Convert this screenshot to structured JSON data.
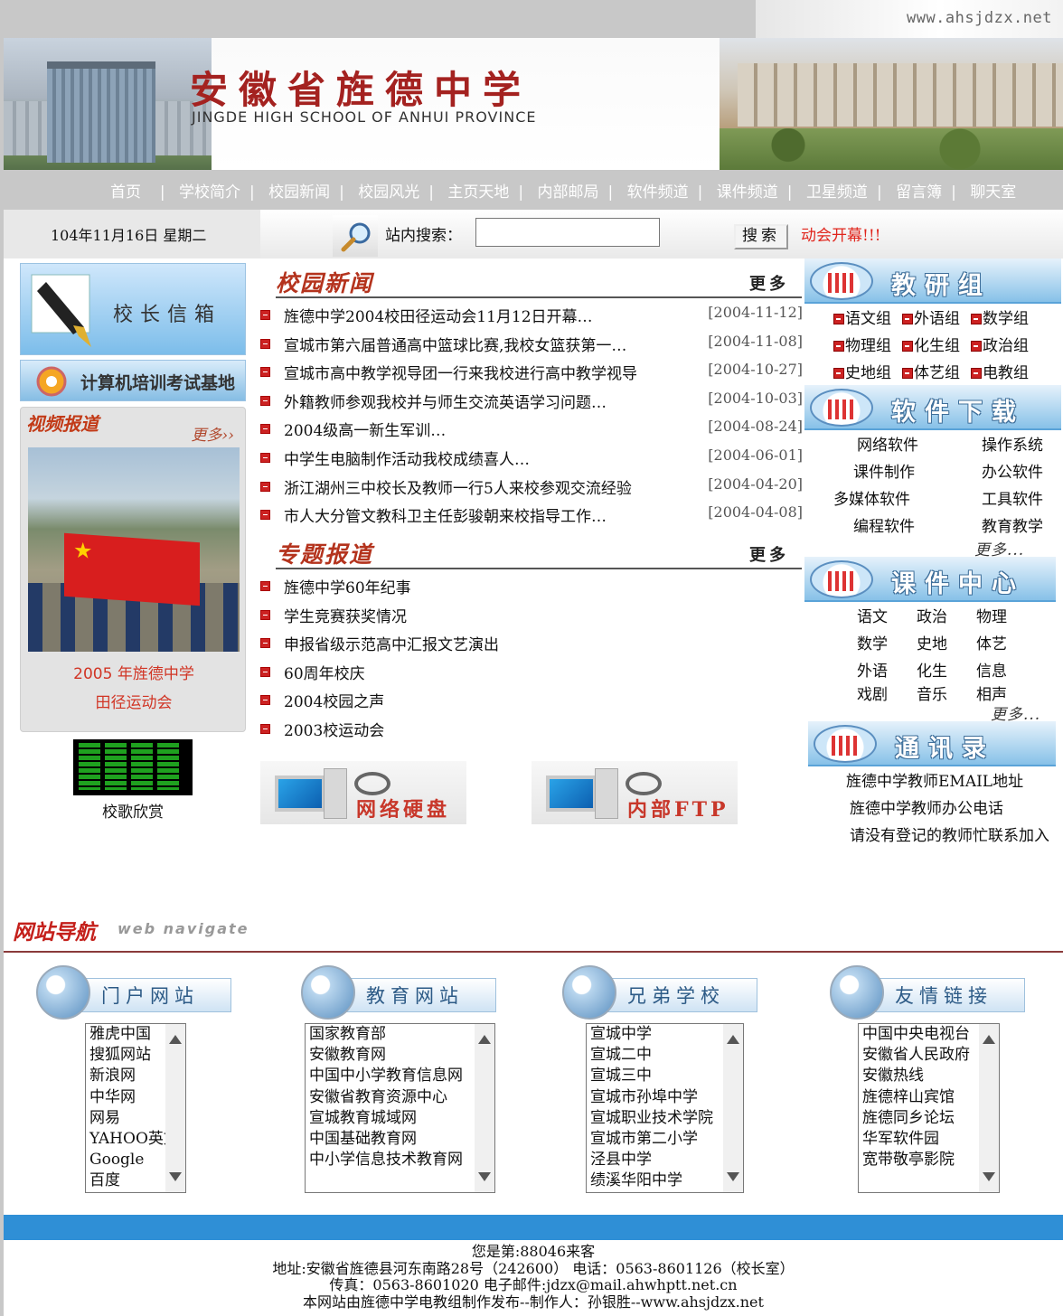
{
  "top": {
    "url": "www.ahsjdzx.net"
  },
  "banner": {
    "title": "安徽省旌德中学",
    "subtitle": "JINGDE HIGH SCHOOL OF ANHUI PROVINCE"
  },
  "nav": {
    "items": [
      "首页",
      "学校简介",
      "校园新闻",
      "校园风光",
      "主页天地",
      "内部邮局",
      "软件频道",
      "课件频道",
      "卫星频道",
      "留言簿",
      "聊天室"
    ]
  },
  "date_text": "104年11月16日  星期二",
  "search": {
    "label": "站内搜索：",
    "value": "",
    "button": "搜索",
    "marquee": "动会开幕!!!"
  },
  "left": {
    "mailbox_label": "校长信箱",
    "training_label": "计算机培训考试基地",
    "video_title": "视频报道",
    "video_more": "更多››",
    "video_caption_1": "2005 年旌德中学",
    "video_caption_2": "田径运动会",
    "song_label": "校歌欣赏"
  },
  "news": {
    "title": "校园新闻",
    "more": "更多",
    "items": [
      {
        "text": "旌德中学2004校田径运动会11月12日开幕…",
        "date": "[2004-11-12]"
      },
      {
        "text": "宣城市第六届普通高中篮球比赛,我校女篮获第一…",
        "date": "[2004-11-08]"
      },
      {
        "text": "宣城市高中教学视导团一行来我校进行高中教学视导",
        "date": "[2004-10-27]"
      },
      {
        "text": "外籍教师参观我校并与师生交流英语学习问题…",
        "date": "[2004-10-03]"
      },
      {
        "text": "2004级高一新生军训…",
        "date": "[2004-08-24]"
      },
      {
        "text": "中学生电脑制作活动我校成绩喜人…",
        "date": "[2004-06-01]"
      },
      {
        "text": "浙江湖州三中校长及教师一行5人来校参观交流经验",
        "date": "[2004-04-20]"
      },
      {
        "text": "市人大分管文教科卫主任彭骏朝来校指导工作…",
        "date": "[2004-04-08]"
      }
    ]
  },
  "topics": {
    "title": "专题报道",
    "more": "更多",
    "items": [
      "旌德中学60年纪事",
      "学生竞赛获奖情况",
      "申报省级示范高中汇报文艺演出",
      "60周年校庆",
      "2004校园之声",
      "2003校运动会"
    ]
  },
  "banners": {
    "disk": "网络硬盘",
    "ftp": "内部FTP"
  },
  "right": {
    "research": {
      "title": "教研组",
      "groups": [
        "语文组",
        "外语组",
        "数学组",
        "物理组",
        "化生组",
        "政治组",
        "史地组",
        "体艺组",
        "电教组"
      ]
    },
    "software": {
      "title": "软件下载",
      "items": [
        "网络软件",
        "操作系统",
        "课件制作",
        "办公软件",
        "多媒体软件",
        "工具软件",
        "编程软件",
        "教育教学"
      ],
      "more": "更多..."
    },
    "courseware": {
      "title": "课件中心",
      "items": [
        "语文",
        "政治",
        "物理",
        "数学",
        "史地",
        "体艺",
        "外语",
        "化生",
        "信息",
        "戏剧",
        "音乐",
        "相声"
      ],
      "more": "更多..."
    },
    "contacts": {
      "title": "通讯录",
      "items": [
        "旌德中学教师EMAIL地址",
        "旌德中学教师办公电话",
        "请没有登记的教师忙联系加入"
      ]
    }
  },
  "navigate": {
    "heading": "网站导航",
    "heading_en": "web navigate",
    "categories": [
      {
        "title": "门户网站",
        "links": [
          "雅虎中国",
          "搜狐网站",
          "新浪网",
          "中华网",
          "网易",
          "YAHOO英文",
          "Google",
          "百度"
        ]
      },
      {
        "title": "教育网站",
        "links": [
          "国家教育部",
          "安徽教育网",
          "中国中小学教育信息网",
          "安徽省教育资源中心",
          "宣城教育城域网",
          "中国基础教育网",
          "中小学信息技术教育网"
        ]
      },
      {
        "title": "兄弟学校",
        "links": [
          "宣城中学",
          "宣城二中",
          "宣城三中",
          "宣城市孙埠中学",
          "宣城职业技术学院",
          "宣城市第二小学",
          "泾县中学",
          "绩溪华阳中学"
        ]
      },
      {
        "title": "友情链接",
        "links": [
          "中国中央电视台",
          "安徽省人民政府",
          "安徽热线",
          "旌德梓山宾馆",
          "旌德同乡论坛",
          "华军软件园",
          "宽带敬亭影院"
        ]
      }
    ]
  },
  "footer": {
    "visitors": "您是第:88046来客",
    "address": "地址:安徽省旌德县河东南路28号（242600） 电话：0563-8601126（校长室）",
    "fax": "传真：0563-8601020 电子邮件:jdzx@mail.ahwhptt.net.cn",
    "credit": "本网站由旌德中学电教组制作发布--制作人：孙银胜--www.ahsjdzx.net"
  },
  "colors": {
    "accent_red": "#b4331d",
    "nav_gray": "#c8c8c8",
    "footer_blue": "#2f8fd6"
  }
}
